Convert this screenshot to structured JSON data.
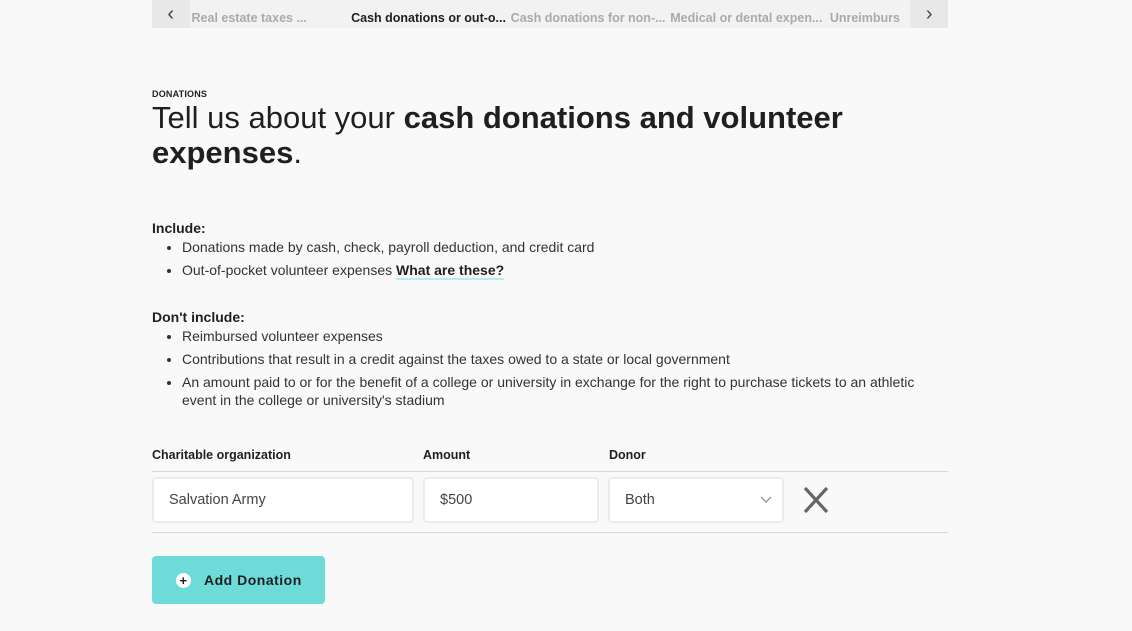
{
  "tabs": {
    "items": [
      "Real estate taxes ...",
      "Cash donations or out-o...",
      "Cash donations for non-...",
      "Medical or dental expen...",
      "Unreimburs"
    ],
    "active": 1
  },
  "eyebrow": "DONATIONS",
  "title": {
    "light": "Tell us about your ",
    "bold": "cash donations and volunteer expenses",
    "end": "."
  },
  "include": {
    "heading": "Include:",
    "items": [
      "Donations made by cash, check, payroll deduction, and credit card",
      "Out-of-pocket volunteer expenses "
    ],
    "link": "What are these?"
  },
  "exclude": {
    "heading": "Don't include:",
    "items": [
      "Reimbursed volunteer expenses",
      "Contributions that result in a credit against the taxes owed to a state or local government",
      "An amount paid to or for the benefit of a college or university in exchange for the right to purchase tickets to an athletic event in the college or university's stadium"
    ]
  },
  "table": {
    "columns": [
      "Charitable organization",
      "Amount",
      "Donor"
    ],
    "row": {
      "organization": "Salvation Army",
      "amount": "$500",
      "donor": "Both"
    }
  },
  "add_button": "Add Donation",
  "colors": {
    "accent": "#6ddcd9"
  }
}
